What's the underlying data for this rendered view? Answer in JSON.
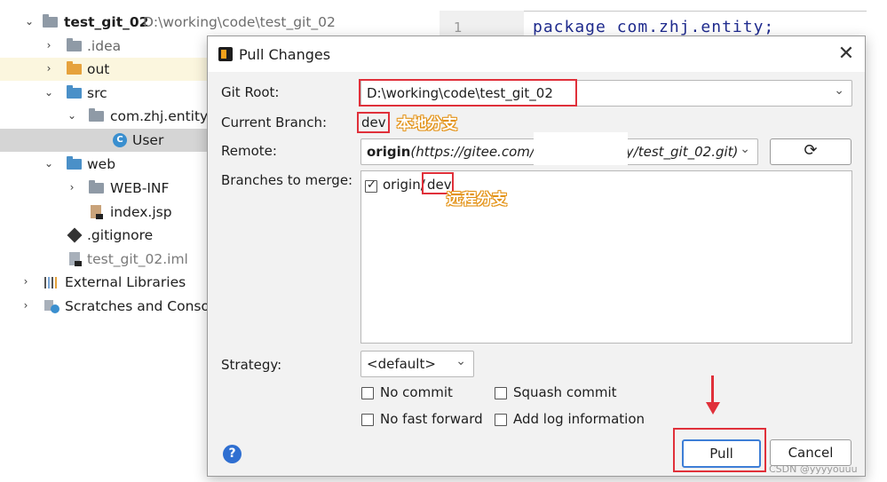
{
  "tree": {
    "root": {
      "name": "test_git_02",
      "path": "D:\\working\\code\\test_git_02"
    },
    "items": [
      {
        "label": ".idea"
      },
      {
        "label": "out"
      },
      {
        "label": "src"
      },
      {
        "label": "com.zhj.entity"
      },
      {
        "label": "User"
      },
      {
        "label": "web"
      },
      {
        "label": "WEB-INF"
      },
      {
        "label": "index.jsp"
      },
      {
        "label": ".gitignore"
      },
      {
        "label": "test_git_02.iml"
      },
      {
        "label": "External Libraries"
      },
      {
        "label": "Scratches and Consoles"
      }
    ]
  },
  "editor": {
    "gutter_number": "1",
    "code_line": "package com.zhj.entity;"
  },
  "dialog": {
    "title": "Pull Changes",
    "git_root_label": "Git Root:",
    "git_root_value": "D:\\working\\code\\test_git_02",
    "current_branch_label": "Current Branch:",
    "current_branch_value": "dev",
    "current_branch_annotation": "本地分支",
    "remote_label": "Remote:",
    "remote_name": "origin",
    "remote_url_start": "(https://gitee.com/z",
    "remote_url_end": "y/test_git_02.git)",
    "branches_label": "Branches to merge:",
    "branch_item": {
      "remote": "origin/",
      "branch": "dev",
      "checked": true
    },
    "branch_annotation": "远程分支",
    "strategy_label": "Strategy:",
    "strategy_value": "<default>",
    "options": {
      "no_commit": "No commit",
      "squash_commit": "Squash commit",
      "no_fast_forward": "No fast forward",
      "add_log": "Add log information"
    },
    "help": "?",
    "pull_button": "Pull",
    "cancel_button": "Cancel"
  },
  "watermark": "CSDN @yyyyouuu",
  "colors": {
    "highlight_red": "#e0303a",
    "accent_blue": "#3d7ed6"
  }
}
